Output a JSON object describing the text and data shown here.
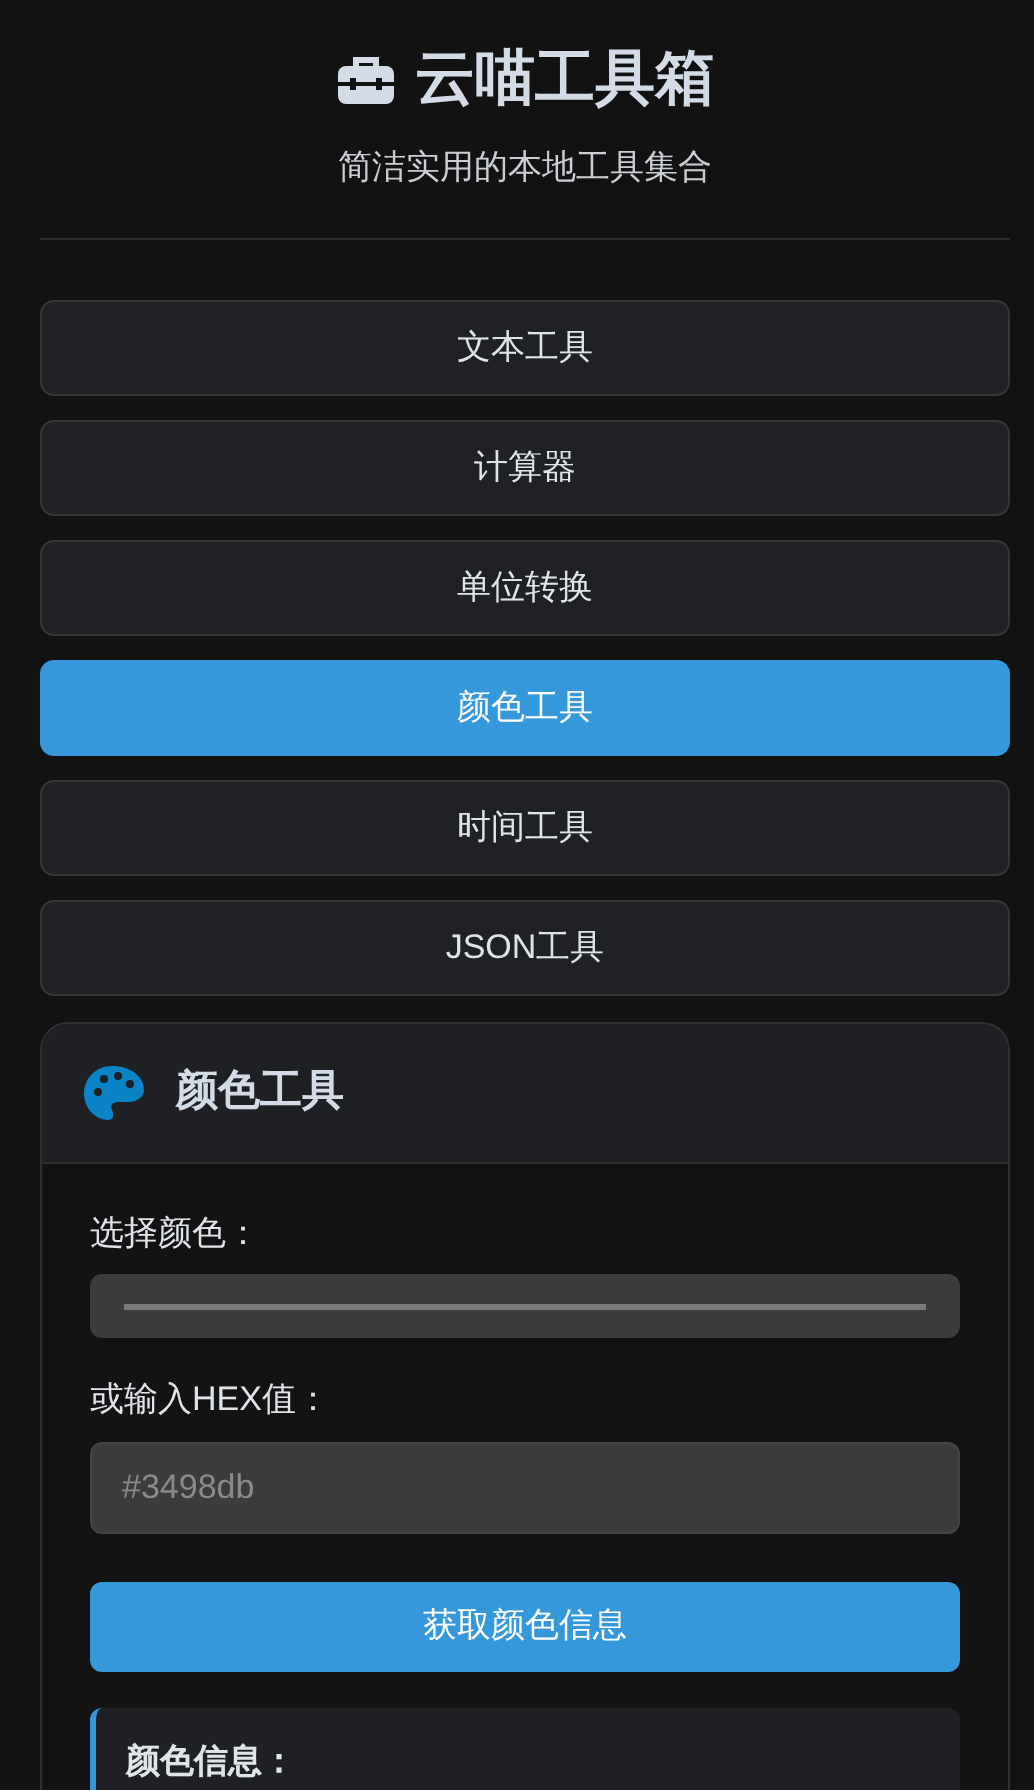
{
  "header": {
    "title": "云喵工具箱",
    "subtitle": "简洁实用的本地工具集合"
  },
  "tools": [
    {
      "label": "文本工具",
      "selected": false
    },
    {
      "label": "计算器",
      "selected": false
    },
    {
      "label": "单位转换",
      "selected": false
    },
    {
      "label": "颜色工具",
      "selected": true
    },
    {
      "label": "时间工具",
      "selected": false
    },
    {
      "label": "JSON工具",
      "selected": false
    }
  ],
  "panel": {
    "title": "颜色工具",
    "picker_label": "选择颜色：",
    "hex_label": "或输入HEX值：",
    "hex_placeholder": "#3498db",
    "button": "获取颜色信息",
    "info_title": "颜色信息："
  }
}
